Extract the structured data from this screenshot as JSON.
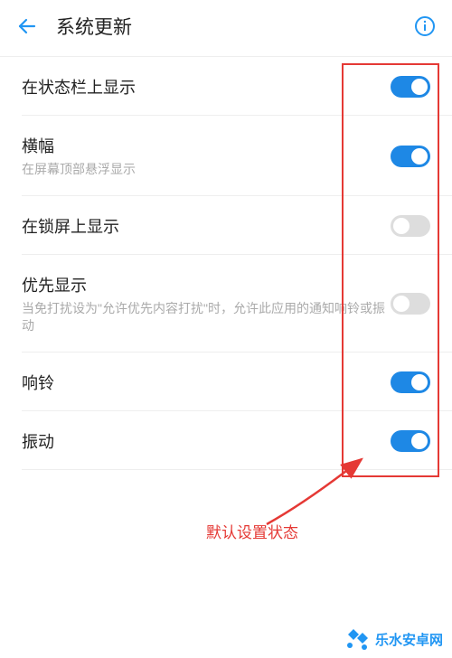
{
  "header": {
    "title": "系统更新"
  },
  "settings": [
    {
      "title": "在状态栏上显示",
      "subtitle": "",
      "on": true
    },
    {
      "title": "横幅",
      "subtitle": "在屏幕顶部悬浮显示",
      "on": true
    },
    {
      "title": "在锁屏上显示",
      "subtitle": "",
      "on": false
    },
    {
      "title": "优先显示",
      "subtitle": "当免打扰设为\"允许优先内容打扰\"时，允许此应用的通知响铃或振动",
      "on": false
    },
    {
      "title": "响铃",
      "subtitle": "",
      "on": true
    },
    {
      "title": "振动",
      "subtitle": "",
      "on": true
    }
  ],
  "annotation": {
    "text": "默认设置状态"
  },
  "watermark": {
    "text": "乐水安卓网"
  }
}
